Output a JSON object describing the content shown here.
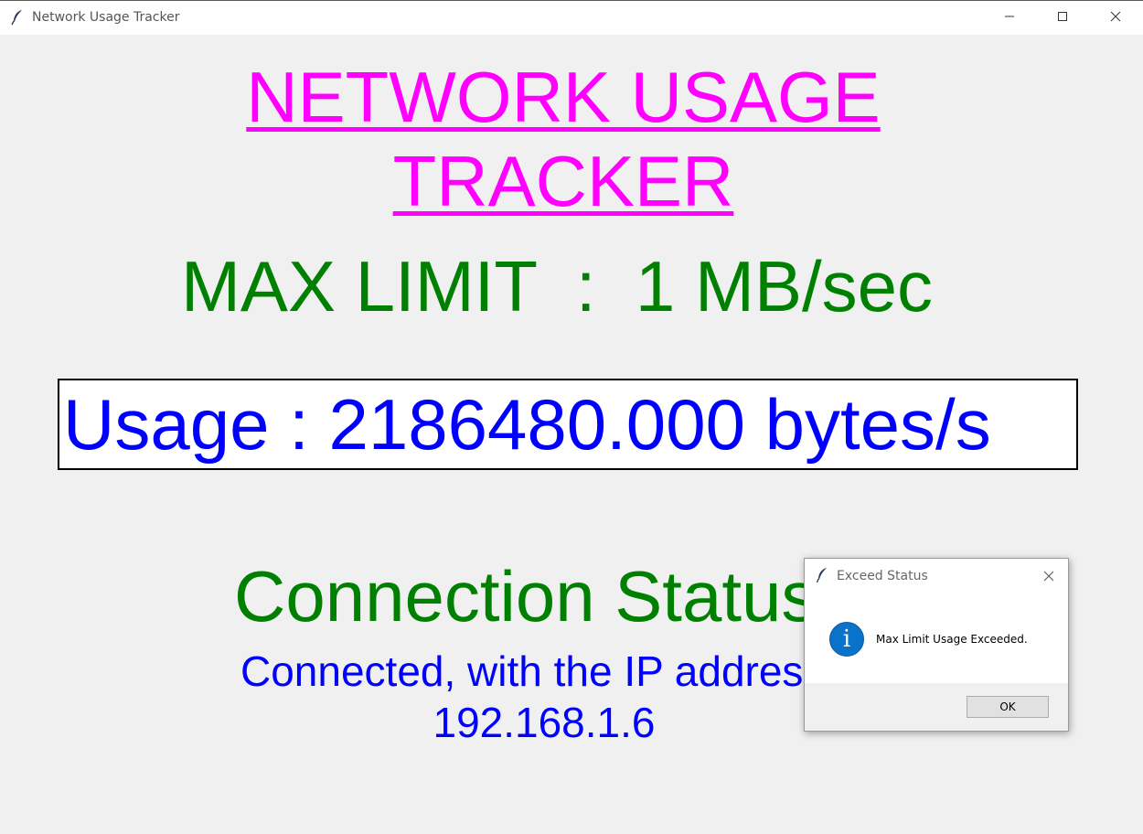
{
  "window": {
    "title": "Network Usage Tracker",
    "icon": "feather-icon",
    "controls": [
      "minimize-icon",
      "maximize-icon",
      "close-icon"
    ]
  },
  "main": {
    "heading_line1": "NETWORK USAGE",
    "heading_line2": "TRACKER",
    "max_limit": "MAX LIMIT  :  1 MB/sec",
    "usage": "Usage : 2186480.000 bytes/s",
    "connection_status_label": "Connection Status",
    "connection_line1": "Connected, with the IP address :",
    "connection_line2": "192.168.1.6"
  },
  "dialog": {
    "title": "Exceed Status",
    "icon": "info-icon",
    "info_glyph": "i",
    "message": "Max Limit Usage Exceeded.",
    "ok_label": "OK"
  },
  "colors": {
    "heading": "#ff00ff",
    "limit_and_status": "#008000",
    "usage_and_connection": "#0000ff",
    "background": "#f0f0f0"
  }
}
